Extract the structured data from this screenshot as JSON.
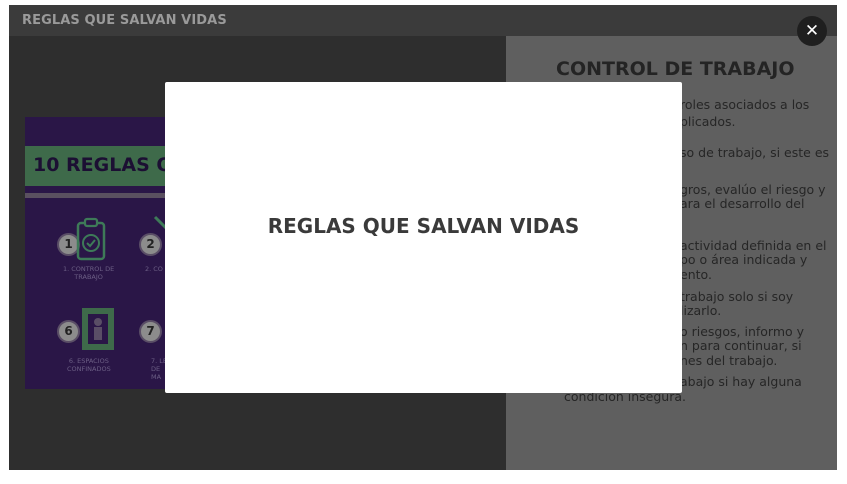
{
  "window": {
    "title": "REGLAS QUE SALVAN VIDAS"
  },
  "close_icon_glyph": "✕",
  "poster": {
    "title": "10 REGLAS QU",
    "items": [
      {
        "number": "1",
        "caption_lines": [
          "1. CONTROL DE",
          "TRABAJO"
        ]
      },
      {
        "number": "2",
        "caption_lines": [
          "2. CO"
        ]
      },
      {
        "number": "6",
        "caption_lines": [
          "6. ESPACIOS",
          "CONFINADOS"
        ]
      },
      {
        "number": "7",
        "caption_lines": [
          "7. LEV",
          "DE",
          "MA"
        ]
      }
    ]
  },
  "right_panel": {
    "title": "CONTROL DE TRABAJO",
    "lines": [
      "roles asociados a los",
      "plicados.",
      "so de trabajo, si este es",
      "gros, evalúo el riesgo y",
      "ara el desarrollo del",
      "actividad definida en el",
      "po o área indicada y",
      "ento.",
      "trabajo solo si soy",
      "lizarlo.",
      "o riesgos, informo y",
      "n para continuar, si",
      "nes del trabajo.",
      "abajo si hay alguna",
      "condición insegura."
    ]
  },
  "modal": {
    "title": "REGLAS QUE SALVAN VIDAS"
  },
  "colors": {
    "overlay_background": "#2e2e2e",
    "right_panel": "#5f5f5f",
    "poster_background": "#2a1647",
    "poster_band": "#3e6a4a",
    "modal_background": "#ffffff"
  }
}
